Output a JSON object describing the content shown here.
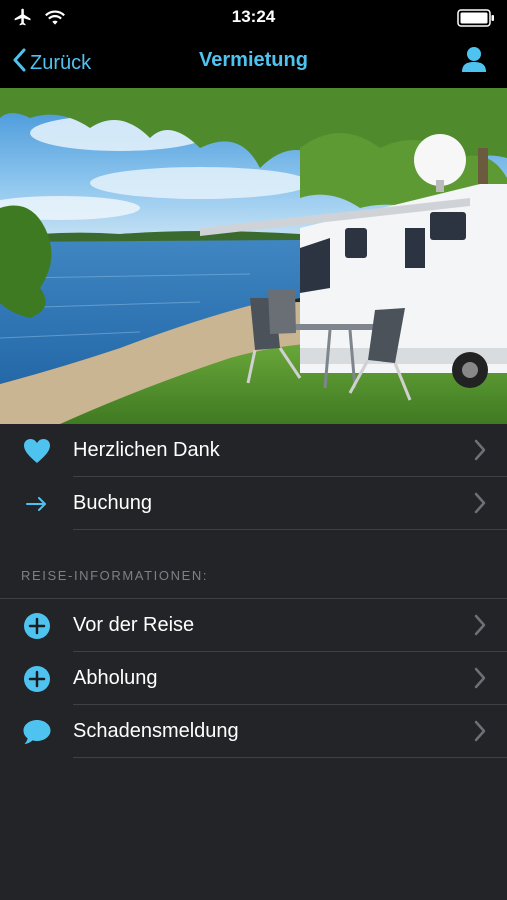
{
  "status_bar": {
    "time": "13:24",
    "icons": [
      "airplane-icon",
      "wifi-icon",
      "battery-icon"
    ]
  },
  "nav": {
    "back_label": "Zurück",
    "title": "Vermietung",
    "right_icon": "person-icon"
  },
  "colors": {
    "accent": "#4fc3f0",
    "background": "#222427",
    "separator": "#3d4045",
    "section_header": "#7d8087"
  },
  "hero": {
    "description": "Wohnmobil am See"
  },
  "main_list": [
    {
      "label": "Herzlichen Dank",
      "icon": "heart-icon"
    },
    {
      "label": "Buchung",
      "icon": "arrow-right-icon"
    }
  ],
  "section": {
    "title": "REISE-INFORMATIONEN:",
    "items": [
      {
        "label": "Vor der Reise",
        "icon": "plus-circle-icon"
      },
      {
        "label": "Abholung",
        "icon": "plus-circle-icon"
      },
      {
        "label": "Schadensmeldung",
        "icon": "speech-bubble-icon"
      }
    ]
  }
}
